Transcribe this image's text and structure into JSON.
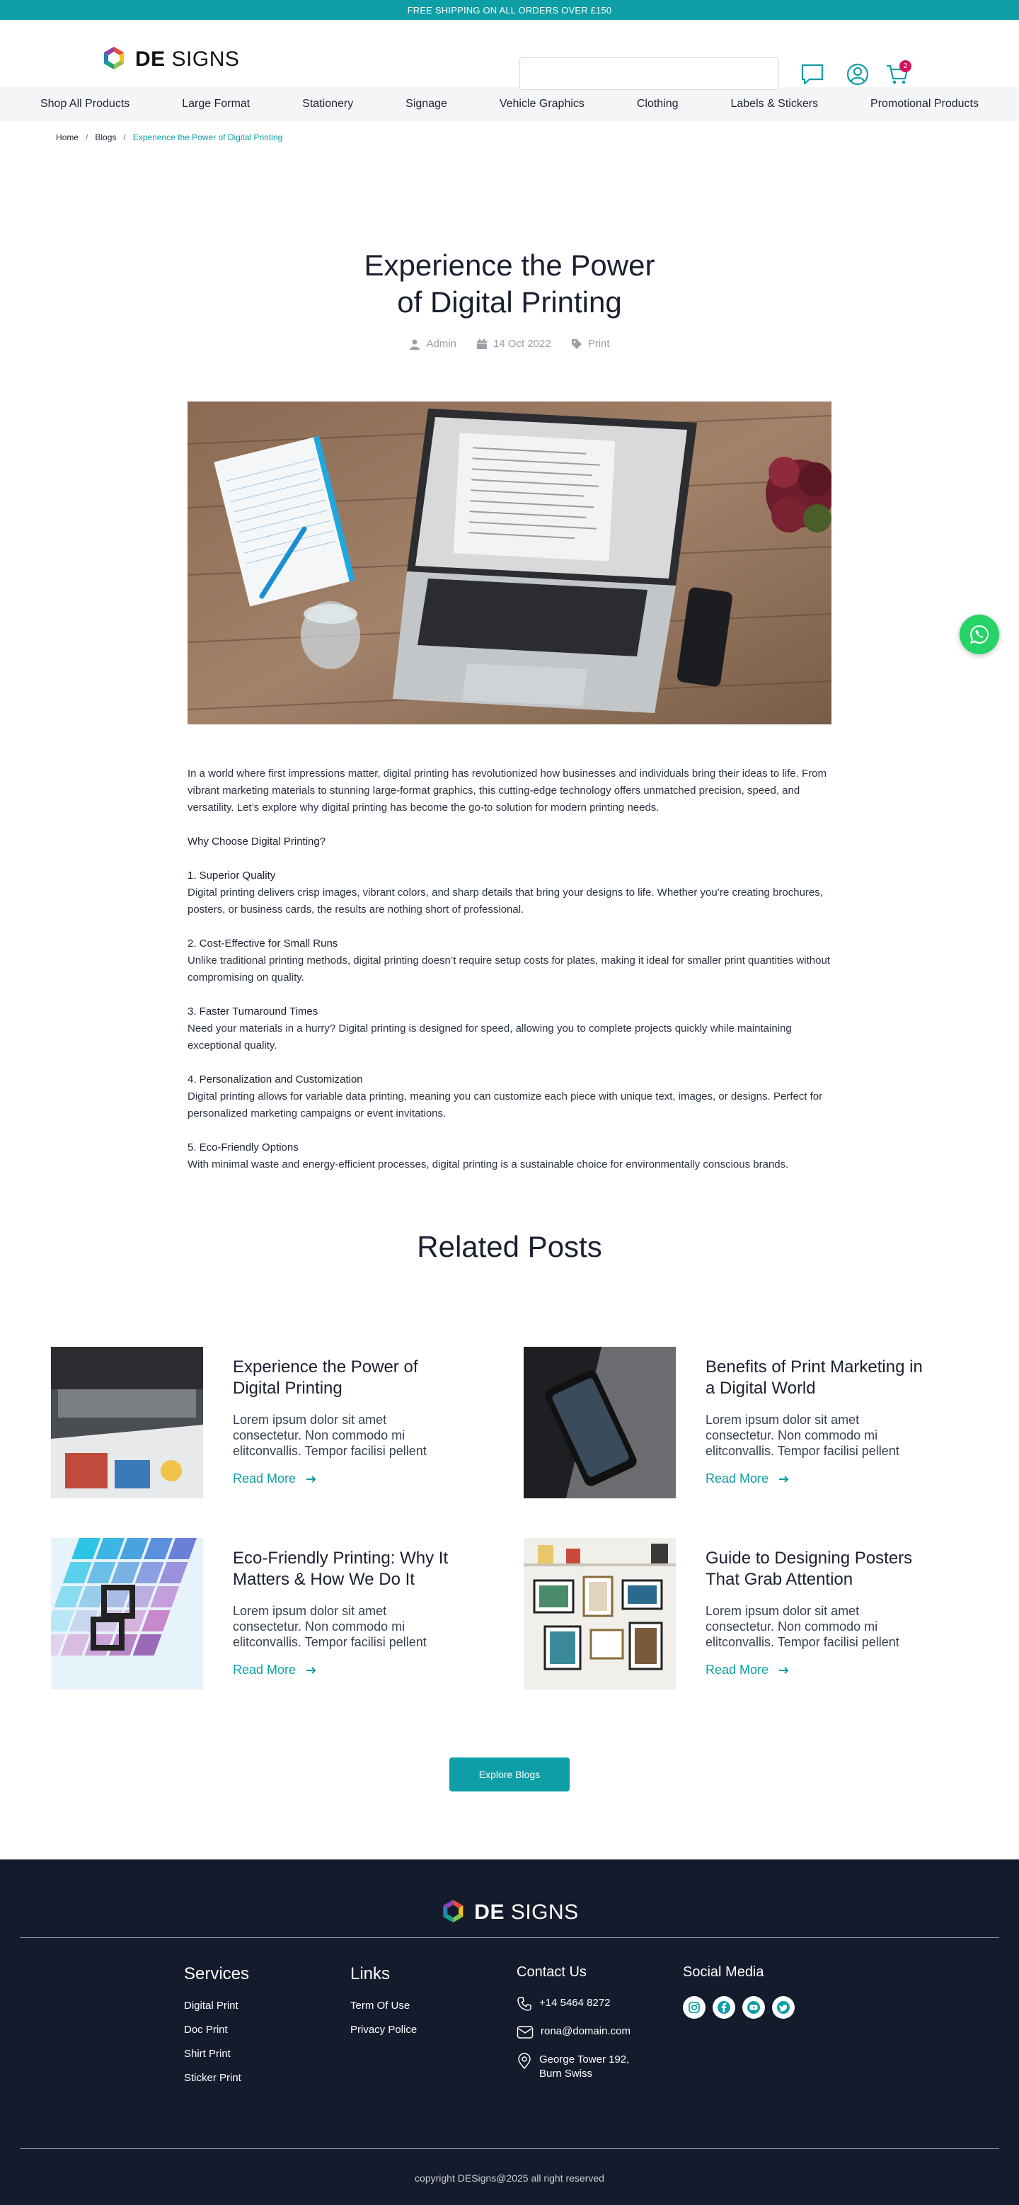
{
  "topbar": {
    "text": "FREE SHIPPING ON ALL ORDERS OVER £150"
  },
  "brand": {
    "bold": "DE",
    "rest": " SIGNS",
    "accent": "#0e9ea6",
    "badge": "#d6135e",
    "footer_bg": "#141b2d"
  },
  "search": {
    "placeholder": "",
    "value": ""
  },
  "header": {
    "cart_count": "2",
    "icons": [
      "chat-icon",
      "user-icon",
      "cart-icon"
    ]
  },
  "nav": {
    "items": [
      {
        "label": "Shop All Products"
      },
      {
        "label": "Large Format"
      },
      {
        "label": "Stationery"
      },
      {
        "label": "Signage"
      },
      {
        "label": "Vehicle Graphics"
      },
      {
        "label": "Clothing"
      },
      {
        "label": "Labels & Stickers"
      },
      {
        "label": "Promotional Products"
      }
    ]
  },
  "breadcrumb": {
    "home": "Home",
    "blogs": "Blogs",
    "current": "Experience the Power of Digital Printing"
  },
  "post": {
    "title_line1": "Experience the Power",
    "title_line2": "of Digital Printing",
    "author": "Admin",
    "date": "14 Oct 2022",
    "category": "Print",
    "intro": "In a world where first impressions matter, digital printing has revolutionized how businesses and individuals bring their ideas to life. From vibrant marketing materials to stunning large-format graphics, this cutting-edge technology offers unmatched precision, speed, and versatility. Let’s explore why digital printing has become the go-to solution for modern printing needs.",
    "why_heading": "Why Choose Digital Printing?",
    "points": [
      {
        "heading": "1. Superior Quality",
        "text": "Digital printing delivers crisp images, vibrant colors, and sharp details that bring your designs to life. Whether you’re creating brochures, posters, or business cards, the results are nothing short of professional."
      },
      {
        "heading": "2. Cost-Effective for Small Runs",
        "text": "Unlike traditional printing methods, digital printing doesn’t require setup costs for plates, making it ideal for smaller print quantities without compromising on quality."
      },
      {
        "heading": "3. Faster Turnaround Times",
        "text": "Need your materials in a hurry? Digital printing is designed for speed, allowing you to complete projects quickly while maintaining exceptional quality."
      },
      {
        "heading": "4. Personalization and Customization",
        "text": "Digital printing allows for variable data printing, meaning you can customize each piece with unique text, images, or designs. Perfect for personalized marketing campaigns or event invitations."
      },
      {
        "heading": "5. Eco-Friendly Options",
        "text": "With minimal waste and energy-efficient processes, digital printing is a sustainable choice for environmentally conscious brands."
      }
    ]
  },
  "related": {
    "title": "Related Posts",
    "posts": [
      {
        "title": "Experience the Power of Digital Printing",
        "excerpt": "Lorem ipsum dolor sit amet consectetur. Non commodo mi elitconvallis. Tempor facilisi pellent",
        "more": "Read More"
      },
      {
        "title": "Benefits of Print Marketing in a Digital World",
        "excerpt": "Lorem ipsum dolor sit amet consectetur. Non commodo mi elitconvallis. Tempor facilisi pellent",
        "more": "Read More"
      },
      {
        "title": "Eco-Friendly Printing: Why It Matters & How We Do It",
        "excerpt": "Lorem ipsum dolor sit amet consectetur. Non commodo mi elitconvallis. Tempor facilisi pellent",
        "more": "Read More"
      },
      {
        "title": "Guide to Designing Posters That Grab Attention",
        "excerpt": "Lorem ipsum dolor sit amet consectetur. Non commodo mi elitconvallis. Tempor facilisi pellent",
        "more": "Read More"
      }
    ],
    "explore": "Explore Blogs"
  },
  "footer": {
    "services_title": "Services",
    "services": [
      "Digital Print",
      "Doc Print",
      "Shirt Print",
      "Sticker Print"
    ],
    "links_title": "Links",
    "links": [
      "Term Of Use",
      "Privacy Police"
    ],
    "contact_title": "Contact Us",
    "phone": "+14 5464 8272",
    "email": "rona@domain.com",
    "address_line1": "George Tower 192,",
    "address_line2": "Burn Swiss",
    "social_title": "Social Media",
    "socials": [
      "instagram-icon",
      "facebook-icon",
      "youtube-icon",
      "twitter-icon"
    ],
    "copyright": "copyright DESigns@2025 all right reserved"
  }
}
